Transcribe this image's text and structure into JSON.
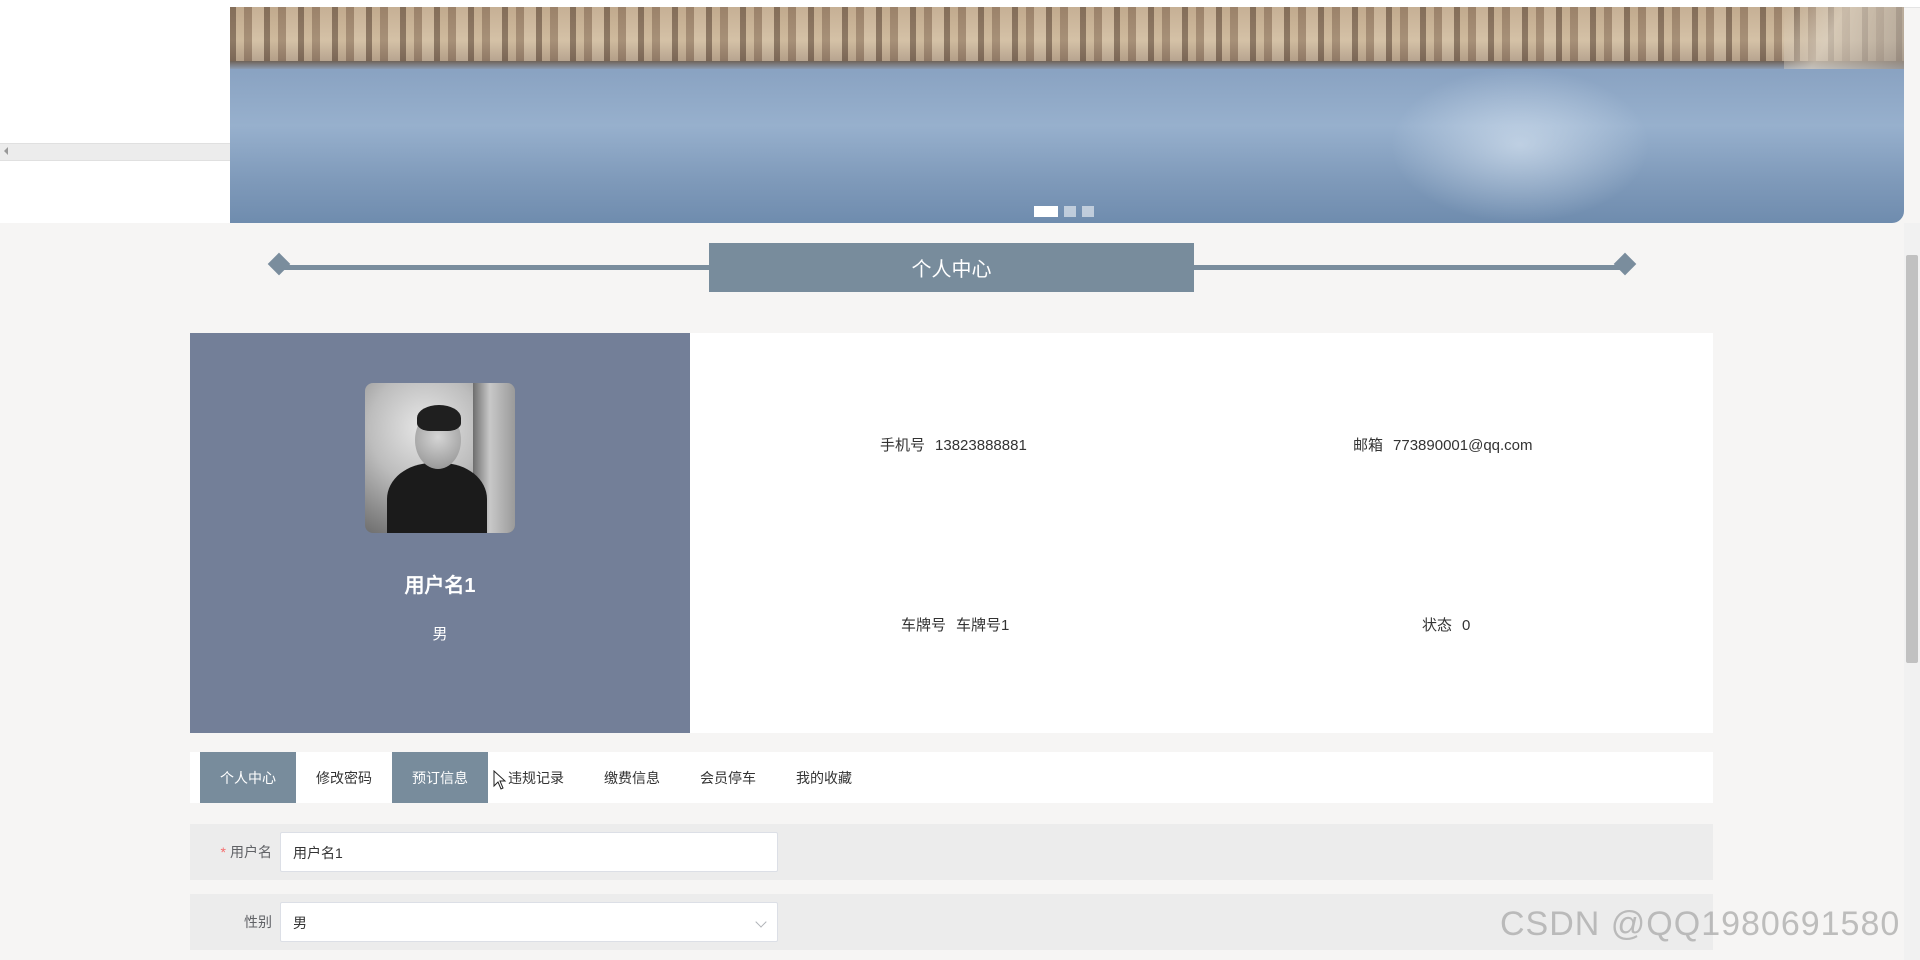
{
  "banner": {
    "slide_count": 3,
    "active_slide": 1
  },
  "section": {
    "title": "个人中心"
  },
  "profile": {
    "username": "用户名1",
    "sex": "男",
    "phone_label": "手机号",
    "phone": "13823888881",
    "email_label": "邮箱",
    "email": "773890001@qq.com",
    "plate_label": "车牌号",
    "plate": "车牌号1",
    "status_label": "状态",
    "status": "0"
  },
  "tabs": [
    {
      "label": "个人中心",
      "active": true
    },
    {
      "label": "修改密码",
      "active": false
    },
    {
      "label": "预订信息",
      "active": true
    },
    {
      "label": "违规记录",
      "active": false
    },
    {
      "label": "缴费信息",
      "active": false
    },
    {
      "label": "会员停车",
      "active": false
    },
    {
      "label": "我的收藏",
      "active": false
    }
  ],
  "form": {
    "username_label": "用户名",
    "username_value": "用户名1",
    "sex_label": "性别",
    "sex_value": "男"
  },
  "colors": {
    "accent": "#788c9c",
    "profile_panel": "#737f98"
  },
  "watermark": "CSDN @QQ1980691580"
}
